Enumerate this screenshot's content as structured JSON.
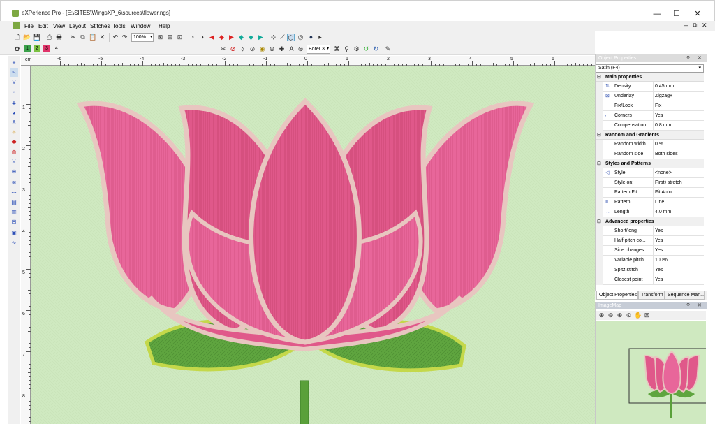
{
  "window": {
    "title": "eXPerience Pro - [E:\\SITES\\WingsXP_6\\sources\\flower.ngs]",
    "minimize": "—",
    "maximize": "☐",
    "close": "✕",
    "mdi_close": "✕",
    "mdi_restore": "⧉"
  },
  "menu": [
    "File",
    "Edit",
    "View",
    "Layout",
    "Stitches",
    "Tools",
    "Window",
    "Help"
  ],
  "toolbar1": {
    "zoom": "100%"
  },
  "toolbar2": {
    "colors": [
      {
        "label": "1",
        "color": "#3aa04a"
      },
      {
        "label": "2",
        "color": "#7bc142"
      },
      {
        "label": "3",
        "color": "#e0346a"
      },
      {
        "label": "4",
        "color": "#f0f0f0"
      }
    ],
    "borer": "Borer 3"
  },
  "ruler": {
    "unit": "cm",
    "labels": [
      "-6",
      "-5",
      "-4",
      "-3",
      "-2",
      "-1",
      "0",
      "1",
      "2",
      "3",
      "4",
      "5",
      "6"
    ],
    "left_labels": [
      "1",
      "2",
      "3",
      "4",
      "5",
      "6",
      "7",
      "8"
    ]
  },
  "object_properties": {
    "title": "Object Properties",
    "pin": "📌",
    "close": "✕",
    "selected": "Satin (F4)",
    "categories": [
      {
        "name": "Main properties",
        "rows": [
          {
            "name": "Density",
            "value": "0.45 mm",
            "icon": "density-icon",
            "glyph": "⇅"
          },
          {
            "name": "Underlay",
            "value": "Zigzag+",
            "icon": "underlay-icon",
            "glyph": "⊠"
          },
          {
            "name": "Fix/Lock",
            "value": "Fix",
            "icon": "",
            "glyph": ""
          },
          {
            "name": "Corners",
            "value": "Yes",
            "icon": "corners-icon",
            "glyph": "⌐"
          },
          {
            "name": "Compensation",
            "value": "0.8 mm",
            "icon": "",
            "glyph": ""
          }
        ]
      },
      {
        "name": "Random and Gradients",
        "rows": [
          {
            "name": "Random width",
            "value": "0 %",
            "icon": "",
            "glyph": ""
          },
          {
            "name": "Random side",
            "value": "Both sides",
            "icon": "",
            "glyph": ""
          }
        ]
      },
      {
        "name": "Styles and Patterns",
        "rows": [
          {
            "name": "Style",
            "value": "<none>",
            "icon": "style-icon",
            "glyph": "◁"
          },
          {
            "name": "Style on:",
            "value": "First+stretch",
            "icon": "",
            "glyph": ""
          },
          {
            "name": "Pattern Fit",
            "value": "Fit Auto",
            "icon": "",
            "glyph": ""
          },
          {
            "name": "Pattern",
            "value": "Line",
            "icon": "pattern-icon",
            "glyph": "≡"
          },
          {
            "name": "Length",
            "value": "4.0 mm",
            "icon": "length-icon",
            "glyph": "↔"
          }
        ]
      },
      {
        "name": "Advanced properties",
        "rows": [
          {
            "name": "Short/long",
            "value": "Yes",
            "icon": "",
            "glyph": ""
          },
          {
            "name": "Half-pitch co...",
            "value": "Yes",
            "icon": "",
            "glyph": ""
          },
          {
            "name": "Side changes",
            "value": "Yes",
            "icon": "",
            "glyph": ""
          },
          {
            "name": "Variable pitch",
            "value": "100%",
            "icon": "",
            "glyph": ""
          },
          {
            "name": "Spitz stitch",
            "value": "Yes",
            "icon": "",
            "glyph": ""
          },
          {
            "name": "Closest point",
            "value": "Yes",
            "icon": "",
            "glyph": ""
          }
        ]
      }
    ]
  },
  "panel_tabs": [
    "Object Properties",
    "Transform",
    "Sequence Man..."
  ],
  "imagemap": {
    "title": "ImageMap",
    "pin": "📌",
    "close": "✕"
  },
  "colors": {
    "canvas_bg": "#cfe9c0",
    "petal_pink": "#e0588a",
    "petal_border": "#e8c6c0",
    "leaf_green": "#5fa53f",
    "leaf_border": "#c4d84a"
  }
}
